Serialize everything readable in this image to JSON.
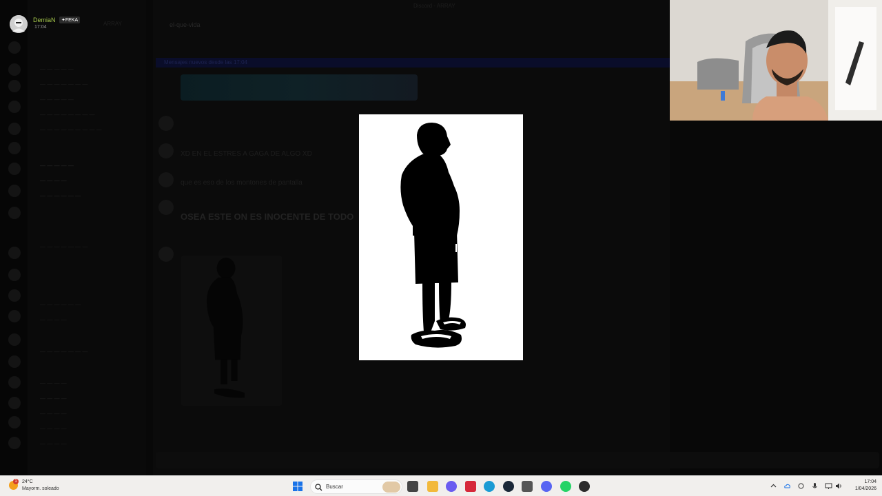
{
  "stream_overlay": {
    "user_name": "DemiaN",
    "user_tag": "✦FEKA",
    "user_time": "17:04"
  },
  "background_app": {
    "window_title": "Discord - ARRAY",
    "server_name": "ARRAY",
    "channel_title": "el-que-vida",
    "unread_label": "Mensajes nuevos desde las 17:04",
    "messages": [
      {
        "text": "XD EN EL ESTRES A GAGA DE ALGO XD"
      },
      {
        "text": "que es eso de los montones de pantalla"
      },
      {
        "text": "OSEA ESTE ON ES INOCENTE DE TODO"
      }
    ]
  },
  "viewer": {
    "image_name": "silhouette-image"
  },
  "taskbar": {
    "weather_temp": "24°C",
    "weather_desc": "Mayorm. soleado",
    "weather_alert_count": "1",
    "search_label": "Buscar",
    "clock_time": "17:04",
    "clock_date": "1/04/2026",
    "pinned_apps": [
      {
        "name": "start-icon",
        "color": "#1a73e8"
      },
      {
        "name": "task-view-icon",
        "color": "#444444"
      },
      {
        "name": "file-explorer-icon",
        "color": "#f2b93b"
      },
      {
        "name": "copilot-icon",
        "color": "#6a5cf0"
      },
      {
        "name": "app-red-icon",
        "color": "#d6283a"
      },
      {
        "name": "edge-icon",
        "color": "#1a9bd4"
      },
      {
        "name": "steam-icon",
        "color": "#1b2838"
      },
      {
        "name": "calculator-icon",
        "color": "#555555"
      },
      {
        "name": "discord-icon",
        "color": "#5865f2"
      },
      {
        "name": "whatsapp-icon",
        "color": "#25d366"
      },
      {
        "name": "obs-icon",
        "color": "#2b2b2b"
      }
    ]
  }
}
